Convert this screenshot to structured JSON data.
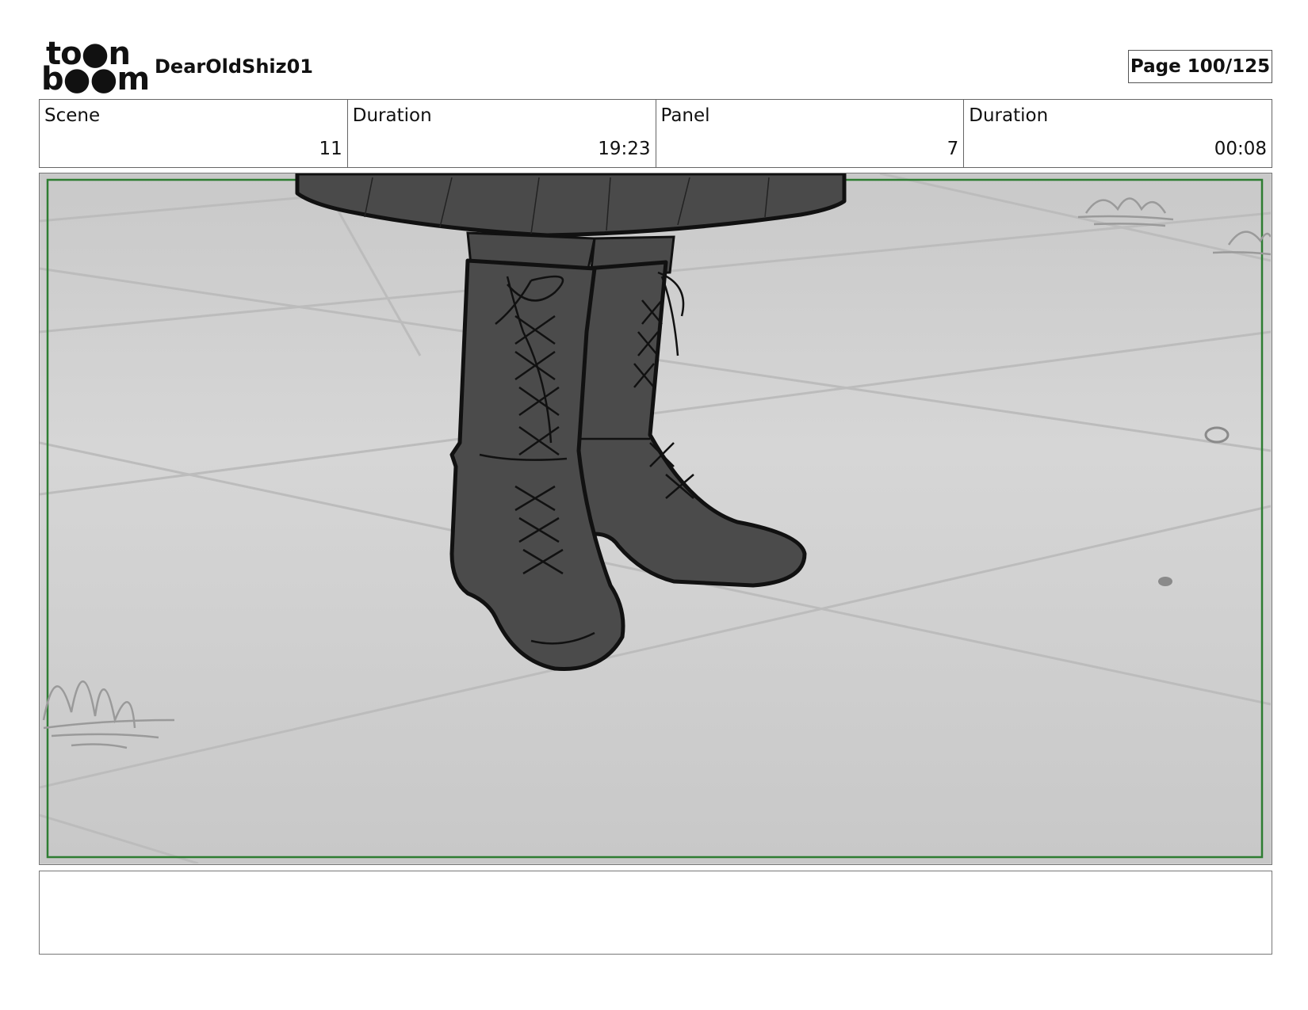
{
  "header": {
    "logo": {
      "line1": "to●n",
      "line2": "b●●m",
      "brand": "toon boom"
    },
    "project_title": "DearOldShiz01",
    "page_label": "Page 100/125"
  },
  "info": {
    "scene_label": "Scene",
    "scene_value": "11",
    "scene_duration_label": "Duration",
    "scene_duration_value": "19:23",
    "panel_label": "Panel",
    "panel_value": "7",
    "panel_duration_label": "Duration",
    "panel_duration_value": "00:08"
  },
  "panel": {
    "safe_frame_color": "#2e7d32",
    "floor_color": "#d2d2d2",
    "boot_color": "#4a4a4a",
    "outline_color": "#111111"
  },
  "notes": {
    "text": ""
  }
}
